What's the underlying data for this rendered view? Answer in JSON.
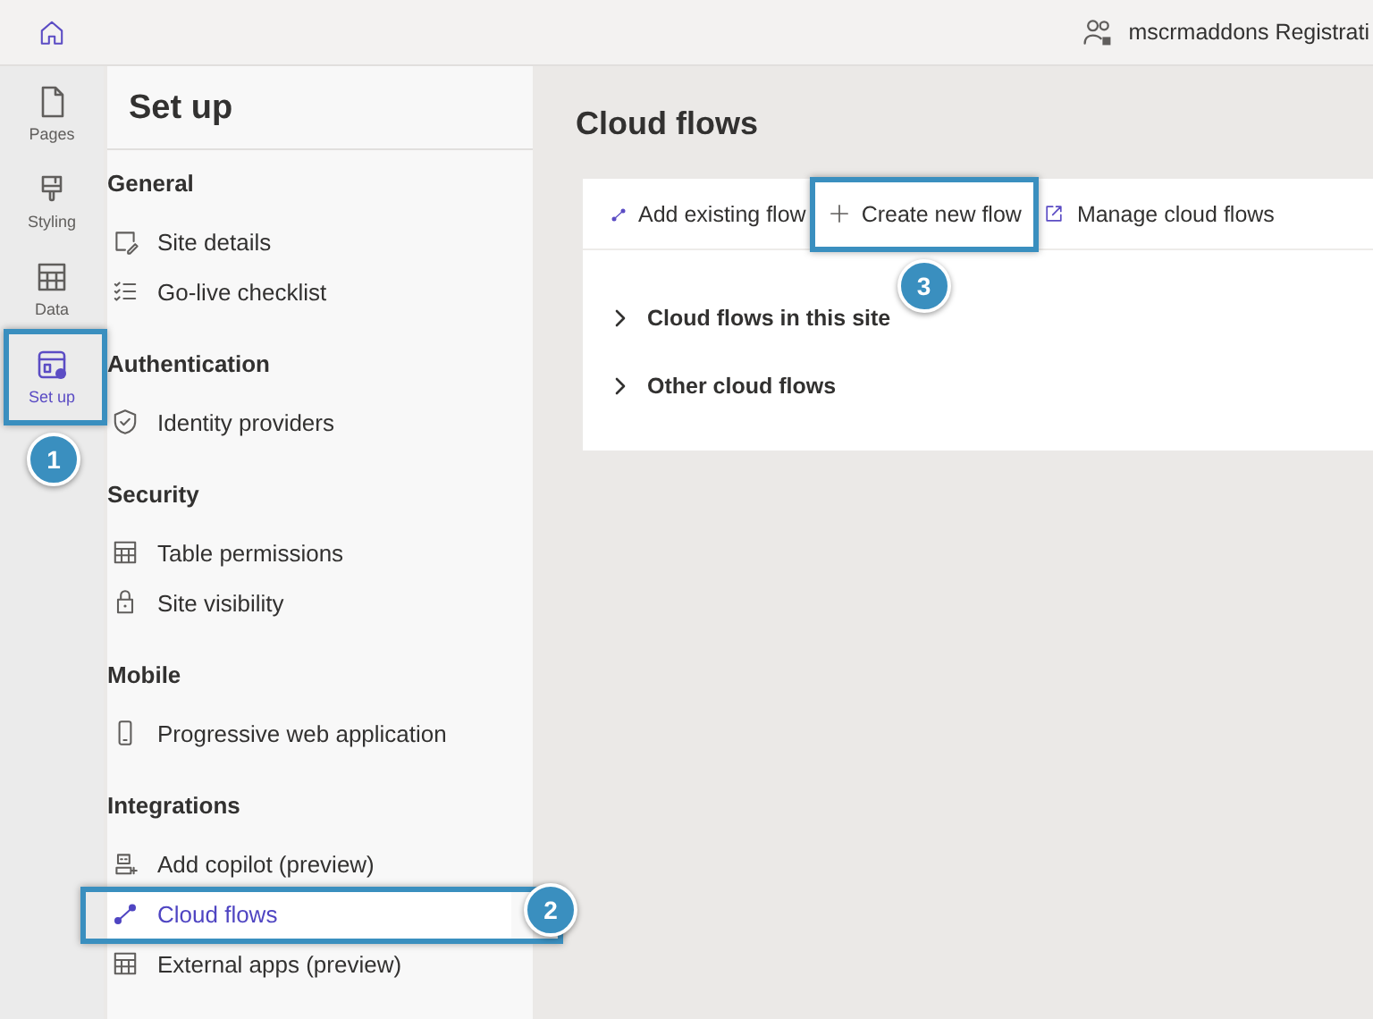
{
  "top_bar": {
    "user_text": "mscrmaddons Registrati"
  },
  "rail": [
    {
      "label": "Pages",
      "selected": false
    },
    {
      "label": "Styling",
      "selected": false
    },
    {
      "label": "Data",
      "selected": false
    },
    {
      "label": "Set up",
      "selected": true,
      "callout": "1"
    }
  ],
  "panel": {
    "title": "Set up",
    "sections": [
      {
        "header": "General",
        "items": [
          {
            "label": "Site details",
            "selected": false
          },
          {
            "label": "Go-live checklist",
            "selected": false
          }
        ]
      },
      {
        "header": "Authentication",
        "items": [
          {
            "label": "Identity providers",
            "selected": false
          }
        ]
      },
      {
        "header": "Security",
        "items": [
          {
            "label": "Table permissions",
            "selected": false
          },
          {
            "label": "Site visibility",
            "selected": false
          }
        ]
      },
      {
        "header": "Mobile",
        "items": [
          {
            "label": "Progressive web application",
            "selected": false
          }
        ]
      },
      {
        "header": "Integrations",
        "items": [
          {
            "label": "Add copilot (preview)",
            "selected": false
          },
          {
            "label": "Cloud flows",
            "selected": true,
            "callout": "2"
          },
          {
            "label": "External apps (preview)",
            "selected": false
          }
        ]
      }
    ]
  },
  "main": {
    "title": "Cloud flows",
    "toolbar": [
      {
        "label": "Add existing flow"
      },
      {
        "label": "Create new flow",
        "callout": "3"
      },
      {
        "label": "Manage cloud flows"
      }
    ],
    "groups": [
      {
        "label": "Cloud flows in this site",
        "expanded": false
      },
      {
        "label": "Other cloud flows",
        "expanded": false
      }
    ]
  }
}
